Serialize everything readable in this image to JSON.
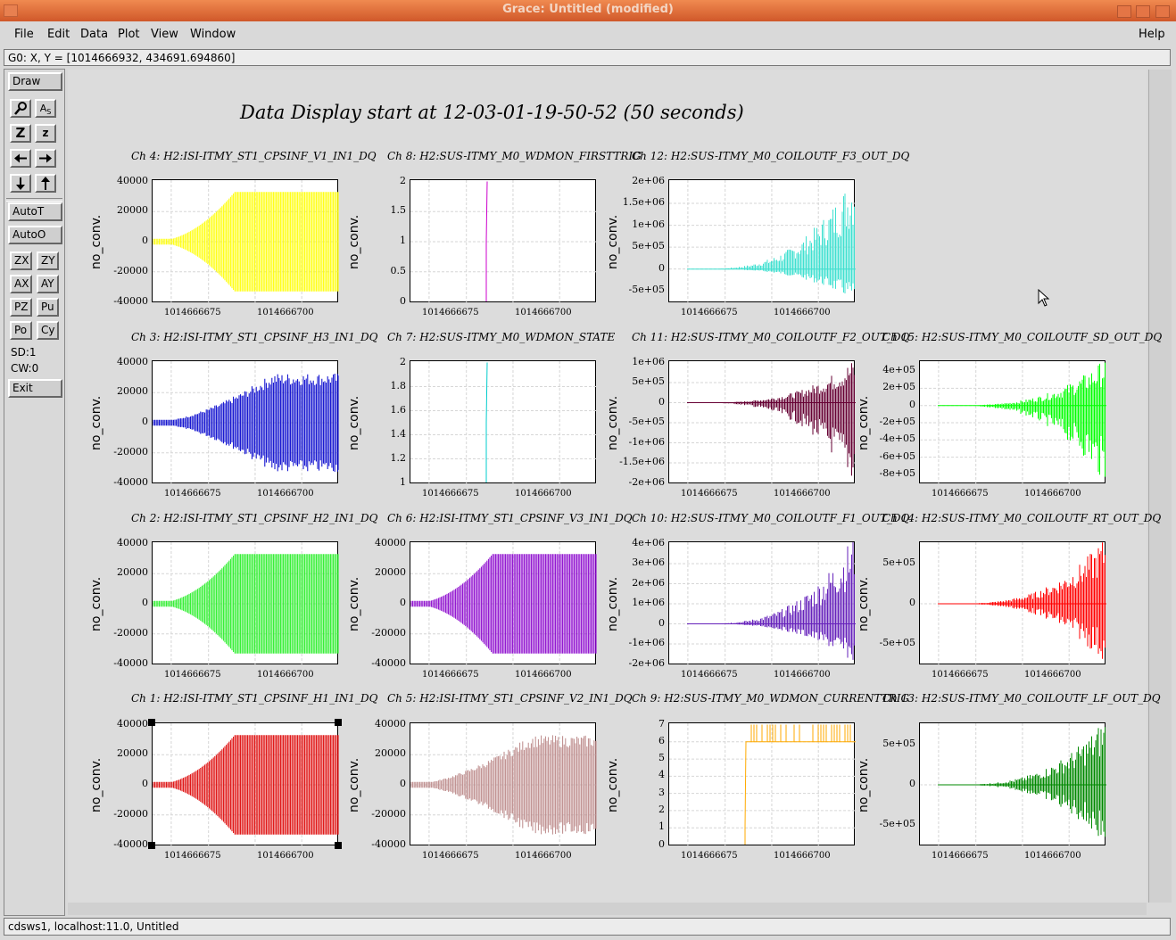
{
  "window": {
    "title": "Grace: Untitled (modified)"
  },
  "menu": {
    "file": "File",
    "edit": "Edit",
    "data": "Data",
    "plot": "Plot",
    "view": "View",
    "window": "Window",
    "help": "Help"
  },
  "locator": "G0: X, Y = [1014666932, 434691.694860]",
  "tools": {
    "draw": "Draw",
    "autot": "AutoT",
    "autoo": "AutoO",
    "zx": "ZX",
    "zy": "ZY",
    "ax": "AX",
    "ay": "AY",
    "pz": "PZ",
    "pu": "Pu",
    "po": "Po",
    "cy": "Cy",
    "sd": "SD:1",
    "cw": "CW:0",
    "exit": "Exit"
  },
  "tool_icons": [
    "zoom-icon",
    "autoscale-text-icon",
    "zoom-in-icon",
    "zoom-out-icon",
    "pan-left-icon",
    "pan-right-icon",
    "pan-down-icon",
    "pan-up-icon"
  ],
  "page_title": "Data Display start at 12-03-01-19-50-52 (50 seconds)",
  "status": "cdsws1, localhost:11.0, Untitled",
  "chart_data": [
    {
      "type": "line",
      "title": "Ch 4: H2:ISI-ITMY_ST1_CPSINF_V1_IN1_DQ",
      "ylabel": "no_conv.",
      "x_ticks": [
        "1014666675",
        "1014666700"
      ],
      "y_ticks": [
        "40000",
        "20000",
        "0",
        "-20000",
        "-40000"
      ],
      "ylim": [
        -40000,
        40000
      ],
      "color": "#ffff00"
    },
    {
      "type": "line",
      "title": "Ch 8: H2:SUS-ITMY_M0_WDMON_FIRSTTRIG",
      "ylabel": "no_conv.",
      "x_ticks": [
        "1014666675",
        "1014666700"
      ],
      "y_ticks": [
        "2",
        "1.5",
        "1",
        "0.5",
        "0"
      ],
      "ylim": [
        0,
        2
      ],
      "color": "#cc00cc"
    },
    {
      "type": "line",
      "title": "Ch 12: H2:SUS-ITMY_M0_COILOUTF_F3_OUT_DQ",
      "ylabel": "no_conv.",
      "x_ticks": [
        "1014666675",
        "1014666700"
      ],
      "y_ticks": [
        "2e+06",
        "1.5e+06",
        "1e+06",
        "5e+05",
        "0",
        "-5e+05"
      ],
      "ylim": [
        -750000,
        2000000
      ],
      "color": "#40e0d0"
    },
    {
      "type": "line",
      "title": "Ch 3: H2:ISI-ITMY_ST1_CPSINF_H3_IN1_DQ",
      "ylabel": "no_conv.",
      "x_ticks": [
        "1014666675",
        "1014666700"
      ],
      "y_ticks": [
        "40000",
        "20000",
        "0",
        "-20000",
        "-40000"
      ],
      "ylim": [
        -40000,
        40000
      ],
      "color": "#0000cc"
    },
    {
      "type": "line",
      "title": "Ch 7: H2:SUS-ITMY_M0_WDMON_STATE",
      "ylabel": "no_conv.",
      "x_ticks": [
        "1014666675",
        "1014666700"
      ],
      "y_ticks": [
        "2",
        "1.8",
        "1.6",
        "1.4",
        "1.2",
        "1"
      ],
      "ylim": [
        1,
        2
      ],
      "color": "#00cccc"
    },
    {
      "type": "line",
      "title": "Ch 11: H2:SUS-ITMY_M0_COILOUTF_F2_OUT_DQ",
      "ylabel": "no_conv.",
      "x_ticks": [
        "1014666675",
        "1014666700"
      ],
      "y_ticks": [
        "1e+06",
        "5e+05",
        "0",
        "-5e+05",
        "-1e+06",
        "-1.5e+06",
        "-2e+06"
      ],
      "ylim": [
        -2000000,
        1000000
      ],
      "color": "#660033"
    },
    {
      "type": "line",
      "title": "Ch 15: H2:SUS-ITMY_M0_COILOUTF_SD_OUT_DQ",
      "ylabel": "no_conv.",
      "x_ticks": [
        "1014666675",
        "1014666700"
      ],
      "y_ticks": [
        "4e+05",
        "2e+05",
        "0",
        "-2e+05",
        "-4e+05",
        "-6e+05",
        "-8e+05"
      ],
      "ylim": [
        -900000,
        500000
      ],
      "color": "#00ff00"
    },
    {
      "type": "line",
      "title": "Ch 2: H2:ISI-ITMY_ST1_CPSINF_H2_IN1_DQ",
      "ylabel": "no_conv.",
      "x_ticks": [
        "1014666675",
        "1014666700"
      ],
      "y_ticks": [
        "40000",
        "20000",
        "0",
        "-20000",
        "-40000"
      ],
      "ylim": [
        -40000,
        40000
      ],
      "color": "#22ee22"
    },
    {
      "type": "line",
      "title": "Ch 6: H2:ISI-ITMY_ST1_CPSINF_V3_IN1_DQ",
      "ylabel": "no_conv.",
      "x_ticks": [
        "1014666675",
        "1014666700"
      ],
      "y_ticks": [
        "40000",
        "20000",
        "0",
        "-20000",
        "-40000"
      ],
      "ylim": [
        -40000,
        40000
      ],
      "color": "#8800cc"
    },
    {
      "type": "line",
      "title": "Ch 10: H2:SUS-ITMY_M0_COILOUTF_F1_OUT_DQ",
      "ylabel": "no_conv.",
      "x_ticks": [
        "1014666675",
        "1014666700"
      ],
      "y_ticks": [
        "4e+06",
        "3e+06",
        "2e+06",
        "1e+06",
        "0",
        "-1e+06",
        "-2e+06"
      ],
      "ylim": [
        -2000000,
        4000000
      ],
      "color": "#6622bb"
    },
    {
      "type": "line",
      "title": "Ch 14: H2:SUS-ITMY_M0_COILOUTF_RT_OUT_DQ",
      "ylabel": "no_conv.",
      "x_ticks": [
        "1014666675",
        "1014666700"
      ],
      "y_ticks": [
        "5e+05",
        "0",
        "-5e+05"
      ],
      "ylim": [
        -750000,
        750000
      ],
      "color": "#ff0000"
    },
    {
      "type": "line",
      "title": "Ch 1: H2:ISI-ITMY_ST1_CPSINF_H1_IN1_DQ",
      "ylabel": "no_conv.",
      "x_ticks": [
        "1014666675",
        "1014666700"
      ],
      "y_ticks": [
        "40000",
        "20000",
        "0",
        "-20000",
        "-40000"
      ],
      "ylim": [
        -40000,
        40000
      ],
      "color": "#dd0000"
    },
    {
      "type": "line",
      "title": "Ch 5: H2:ISI-ITMY_ST1_CPSINF_V2_IN1_DQ",
      "ylabel": "no_conv.",
      "x_ticks": [
        "1014666675",
        "1014666700"
      ],
      "y_ticks": [
        "40000",
        "20000",
        "0",
        "-20000",
        "-40000"
      ],
      "ylim": [
        -40000,
        40000
      ],
      "color": "#bb8888"
    },
    {
      "type": "line",
      "title": "Ch 9: H2:SUS-ITMY_M0_WDMON_CURRENTTRIG",
      "ylabel": "no_conv.",
      "x_ticks": [
        "1014666675",
        "1014666700"
      ],
      "y_ticks": [
        "7",
        "6",
        "5",
        "4",
        "3",
        "2",
        "1",
        "0"
      ],
      "ylim": [
        0,
        7
      ],
      "color": "#ffaa00"
    },
    {
      "type": "line",
      "title": "Ch 13: H2:SUS-ITMY_M0_COILOUTF_LF_OUT_DQ",
      "ylabel": "no_conv.",
      "x_ticks": [
        "1014666675",
        "1014666700"
      ],
      "y_ticks": [
        "5e+05",
        "0",
        "-5e+05"
      ],
      "ylim": [
        -750000,
        750000
      ],
      "color": "#008800"
    }
  ]
}
